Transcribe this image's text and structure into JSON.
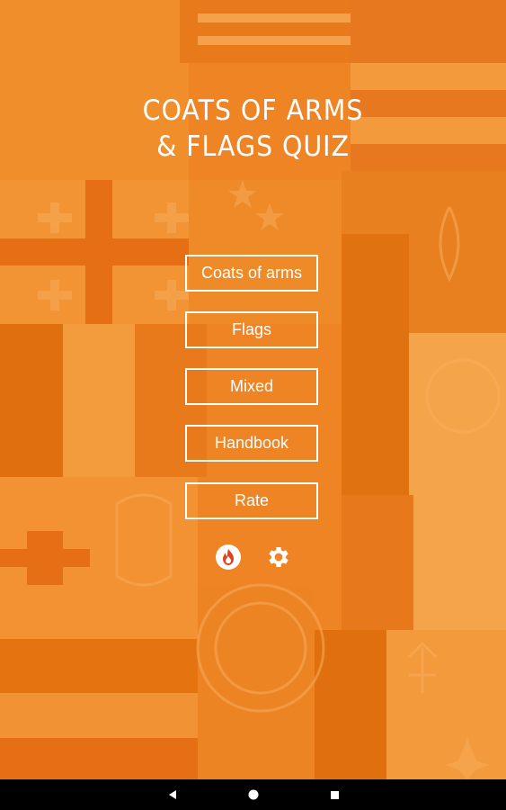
{
  "app": {
    "title_line1": "COATS OF ARMS",
    "title_line2": "& FLAGS QUIZ"
  },
  "menu": {
    "items": [
      {
        "label": "Coats of arms"
      },
      {
        "label": "Flags"
      },
      {
        "label": "Mixed"
      },
      {
        "label": "Handbook"
      },
      {
        "label": "Rate"
      }
    ]
  },
  "bottom_icons": [
    {
      "icon": "flame-icon"
    },
    {
      "icon": "gear-icon"
    }
  ],
  "colors": {
    "background": "#ef8a28",
    "accent_dark": "#e36f10",
    "accent_light": "#f5a24a",
    "text": "#ffffff",
    "navbar": "#000000"
  },
  "navbar": {
    "buttons": [
      {
        "icon": "back-triangle-icon"
      },
      {
        "icon": "home-circle-icon"
      },
      {
        "icon": "recents-square-icon"
      }
    ]
  }
}
